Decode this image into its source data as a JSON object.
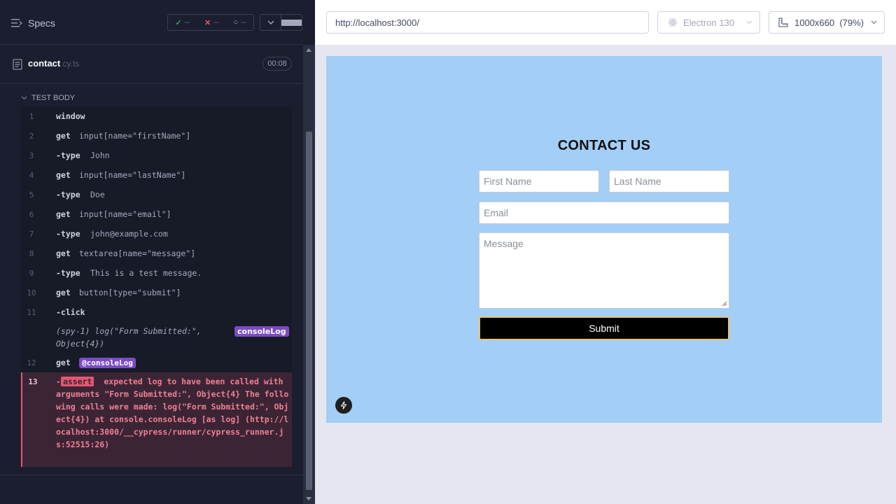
{
  "sidebar": {
    "specs_label": "Specs",
    "stats": {
      "passed": "--",
      "failed": "--",
      "pending": "--"
    },
    "spec": {
      "name": "contact",
      "ext": ".cy.ts",
      "duration": "00:08"
    },
    "test_body_label": "TEST BODY",
    "commands": [
      {
        "num": "1",
        "name": "window",
        "msg": ""
      },
      {
        "num": "2",
        "name": "get",
        "msg": "input[name=\"firstName\"]"
      },
      {
        "num": "3",
        "name": "-type",
        "msg": "John"
      },
      {
        "num": "4",
        "name": "get",
        "msg": "input[name=\"lastName\"]"
      },
      {
        "num": "5",
        "name": "-type",
        "msg": "Doe"
      },
      {
        "num": "6",
        "name": "get",
        "msg": "input[name=\"email\"]"
      },
      {
        "num": "7",
        "name": "-type",
        "msg": "john@example.com"
      },
      {
        "num": "8",
        "name": "get",
        "msg": "textarea[name=\"message\"]"
      },
      {
        "num": "9",
        "name": "-type",
        "msg": "This is a test message."
      },
      {
        "num": "10",
        "name": "get",
        "msg": "button[type=\"submit\"]"
      },
      {
        "num": "11",
        "name": "-click",
        "msg": ""
      },
      {
        "num": "12",
        "name": "get",
        "msg": ""
      }
    ],
    "spy": {
      "text_line1": "(spy-1)  log(\"Form Submitted:\",",
      "text_line2": "Object{4})",
      "badge": "consoleLog"
    },
    "alias_badge": "@consoleLog",
    "error": {
      "num": "13",
      "prefix": "-",
      "assert_label": "assert",
      "message": "expected log to have been called with arguments \"Form Submitted:\", Object{4} The following calls were made: log(\"Form Submitted:\", Object{4}) at console.consoleLog [as log] (http://localhost:3000/__cypress/runner/cypress_runner.js:52515:26)"
    }
  },
  "toolbar": {
    "url": "http://localhost:3000/",
    "browser": "Electron 130",
    "viewport": "1000x660  (79%)"
  },
  "app": {
    "title": "CONTACT US",
    "first_name_placeholder": "First Name",
    "last_name_placeholder": "Last Name",
    "email_placeholder": "Email",
    "message_placeholder": "Message",
    "submit_label": "Submit"
  },
  "colors": {
    "panel_bg": "#1b1e2e",
    "aut_bg": "#a3cef5",
    "error_text": "#f07f93",
    "badge_purple": "#7b4cc4"
  }
}
